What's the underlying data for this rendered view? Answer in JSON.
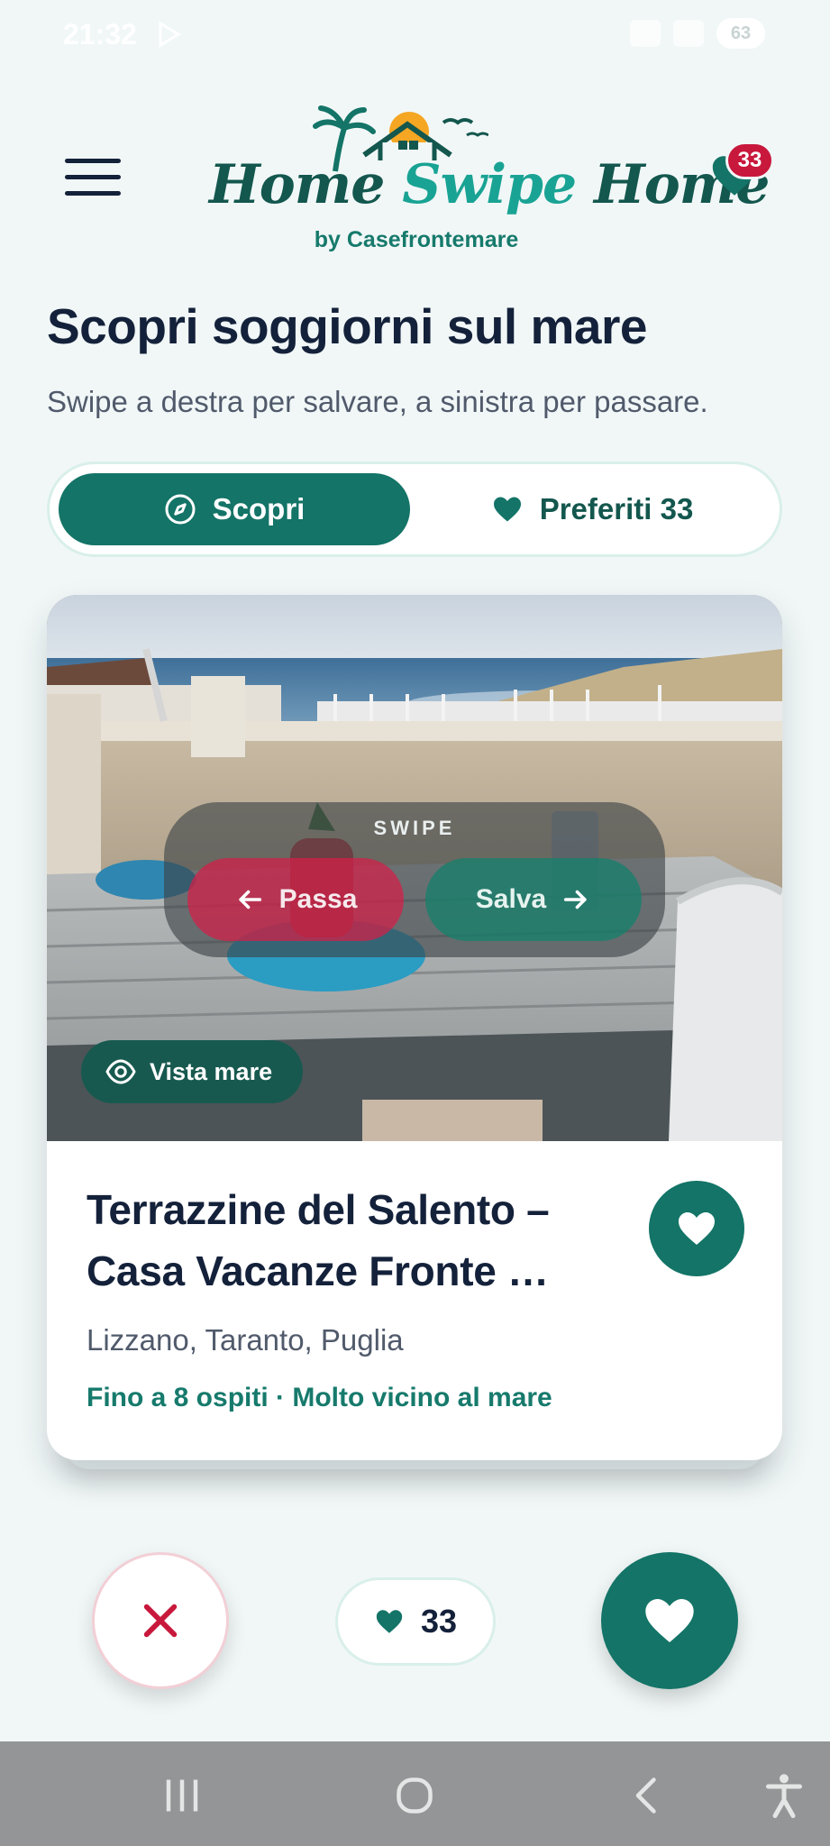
{
  "status_bar": {
    "time": "21:32",
    "battery": "63"
  },
  "header": {
    "brand_part1": "Home ",
    "brand_part2": "Swipe",
    "brand_part3": " Home",
    "brand_sub": "by Casefrontemare",
    "favorites_badge": "33"
  },
  "page": {
    "title": "Scopri soggiorni sul mare",
    "subtitle": "Swipe a destra per salvare, a sinistra per passare."
  },
  "tabs": [
    {
      "label": "Scopri",
      "icon": "compass-icon",
      "active": true
    },
    {
      "label": "Preferiti 33",
      "icon": "heart-icon",
      "active": false
    }
  ],
  "card": {
    "swipe_hint": {
      "label": "SWIPE",
      "pass": "Passa",
      "save": "Salva"
    },
    "badge": "Vista mare",
    "title": "Terrazzine del Salento – Casa Vacanze Fronte …",
    "location": "Lizzano, Taranto, Puglia",
    "meta": "Fino a 8 ospiti · Molto vicino al mare"
  },
  "actions": {
    "favorites_count": "33"
  },
  "colors": {
    "primary": "#137467",
    "primary_dark": "#17594f",
    "accent_red": "#c8183c",
    "background": "#f1f7f7",
    "text_dark": "#14213a"
  }
}
